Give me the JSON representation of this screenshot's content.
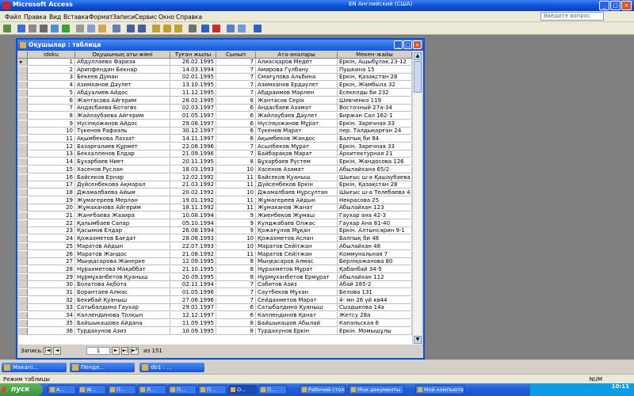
{
  "app": {
    "title": "Microsoft Access",
    "lang_indicator": "EN Английский (США)"
  },
  "menu": [
    "Файл",
    "Правка",
    "Вид",
    "Вставка",
    "Формат",
    "Записи",
    "Сервис",
    "Окно",
    "Справка"
  ],
  "help_placeholder": "Введите вопрос",
  "table_window": {
    "title": "Оқушылар : таблица",
    "columns": [
      "idoku",
      "Оқушының аты-жөні",
      "Туған жылы",
      "Сынып",
      "Ата-аналары",
      "Мекен-жайы"
    ],
    "rows": [
      [
        "1",
        "Абдуллаева Фариза",
        "26.02.1995",
        "7",
        "Алиасқаров Медет",
        "Еркін, Ащыбұлақ 23-12"
      ],
      [
        "2",
        "Арипфендин Бекнар",
        "14.03.1994",
        "7",
        "Амирова Гүлбану",
        "Пушкина 15"
      ],
      [
        "3",
        "Бекеев Думан",
        "02.01.1995",
        "7",
        "Смағұлова Альбина",
        "Еркін, Қазақстан 28"
      ],
      [
        "4",
        "Азимханов Дәулет",
        "13.10.1995",
        "7",
        "Азимханов Ердәулет",
        "Еркін, Жамбыла 32"
      ],
      [
        "5",
        "Абдуалиев Айдос",
        "11.12.1995",
        "7",
        "Абдраимов Марлен",
        "Есекелды би 232"
      ],
      [
        "6",
        "Жантасова Айгерим",
        "28.02.1995",
        "8",
        "Жантасов Серік",
        "Шевченко 119"
      ],
      [
        "7",
        "Андасбаева Ботагөз",
        "02.03.1997",
        "6",
        "Андасбаев Азамат",
        "Восточный 27а-34"
      ],
      [
        "8",
        "Жайлаубаева Айгерим",
        "01.05.1997",
        "6",
        "Жайлаубаев Дәулет",
        "Биржан Сал 162-1"
      ],
      [
        "9",
        "Нүсіпқожанов Айдос",
        "29.08.1997",
        "6",
        "Нүсіпқожанов Мұрат",
        "Еркін. Заречная 33"
      ],
      [
        "10",
        "Түкенов Рафаэль",
        "30.12.1997",
        "6",
        "Түкенов Марат",
        "пер. Талдықорған 24"
      ],
      [
        "11",
        "Ақымбекова Лаззат",
        "14.11.1997",
        "6",
        "Ақымбеков Жандос",
        "Балпық би 84"
      ],
      [
        "12",
        "Базарғалиев Құрмет",
        "22.08.1996",
        "7",
        "Асылбеков Мұрат",
        "Еркін. Заречная 33"
      ],
      [
        "13",
        "Бекхалленов Елдар",
        "21.09.1996",
        "7",
        "Байбарақов Марат",
        "Архитектурная 21"
      ],
      [
        "14",
        "Бұхарбаев Ниет",
        "20.11.1995",
        "8",
        "Бұхарбаев Рүстем",
        "Еркін, Жандосова 126"
      ],
      [
        "15",
        "Хасенов Руслан",
        "18.03.1993",
        "10",
        "Хасенов Азамат",
        "Абылайхана 65/2"
      ],
      [
        "16",
        "Байсеков Ернар",
        "12.02.1992",
        "11",
        "Байсеков Қуаныш",
        "Шығыс ш-а Қашаубаева 21"
      ],
      [
        "17",
        "Дүйсенбекова Ақмарал",
        "21.03.1992",
        "11",
        "Дүйсенбеков Еркін",
        "Еркін, Қазақстан 28"
      ],
      [
        "18",
        "Джамалбаева Айым",
        "20.02.1992",
        "10",
        "Джамалбаев Нұрсұлтан",
        "Шығыс ш-а Телебаева 4"
      ],
      [
        "19",
        "Жұмагереев Мерлан",
        "19.01.1992",
        "11",
        "Жұмагереев Айдын",
        "Некрасова 25"
      ],
      [
        "20",
        "Жұмаханова Айгерим",
        "18.11.1992",
        "11",
        "Жұмаханов Жанат",
        "Абылайхан 123"
      ],
      [
        "21",
        "Жанғбаева Жазира",
        "10.08.1994",
        "9",
        "Жиенбеков Жұмаш",
        "Гаухар ана 42-3"
      ],
      [
        "22",
        "Қалымбаев Сапар",
        "05.10.1994",
        "9",
        "Кулджабаев Олжас",
        "Гаухар Ана 81-40"
      ],
      [
        "23",
        "Қасымов Елдар",
        "26.08.1994",
        "9",
        "Қожағұлов Мұқан",
        "Еркін. Алтынсарин 9-1"
      ],
      [
        "24",
        "Қожахметов Бағдат",
        "28.08.1993",
        "10",
        "Қожахметов Аслан",
        "Балпық би 48"
      ],
      [
        "25",
        "Маратов Айдын",
        "22.07.1993",
        "10",
        "Маратов Сейітжан",
        "Абылайхан 48"
      ],
      [
        "26",
        "Маратов Жандос",
        "21.08.1992",
        "11",
        "Маратов Сейітжан",
        "Коммунальная 7"
      ],
      [
        "27",
        "Мыңқасарова Жәнерке",
        "12.09.1995",
        "8",
        "Мыңқасаров Алмас",
        "Берліқожанова 80"
      ],
      [
        "28",
        "Нұрахметова Мақаббат",
        "21.10.1995",
        "8",
        "Нұрахметов Мұрат",
        "Қабанбай 34-5"
      ],
      [
        "29",
        "Нұрмұханбетов Қуаныш",
        "20.09.1995",
        "8",
        "Нұрмұханбетов Ермұрат",
        "Абылайхан 112"
      ],
      [
        "30",
        "Болатова Ақбота",
        "02.11.1994",
        "7",
        "Сабитов Азиз",
        "Абай 285-2"
      ],
      [
        "31",
        "Борантаев Алмас",
        "01.05.1996",
        "7",
        "Саутбеков Мұхан",
        "Белова 131"
      ],
      [
        "32",
        "Бекибай Қуаныш",
        "27.06.1996",
        "7",
        "Сейдахметов Марат",
        "4- мн 26 үй кв44"
      ],
      [
        "33",
        "Сатыбалдина Гаухар",
        "29.01.1997",
        "6",
        "Сатыбалдина Қуаныш",
        "Сыздыкова 14а"
      ],
      [
        "34",
        "Каллендинова Толқын",
        "12.12.1997",
        "6",
        "Каллендинов Қанат",
        "Жетсу 28а"
      ],
      [
        "35",
        "Байшыкашова Айдана",
        "11.09.1995",
        "8",
        "Байшыкашов Абылай",
        "Капальская 6"
      ],
      [
        "36",
        "Турдахунов Азиз",
        "10.09.1995",
        "8",
        "Турдахунов Еркін",
        "Еркін. Момышұлы"
      ]
    ]
  },
  "record_nav": {
    "label": "Запись:",
    "current": "1",
    "of_label": "из",
    "total": "151"
  },
  "minimized_windows": [
    "Макапі...",
    "Пенде...",
    "db1 : ..."
  ],
  "status": {
    "left": "Режим таблицы",
    "right": "NUM"
  },
  "taskbar": {
    "start": "пуск",
    "items": [
      "A...",
      "W...",
      "П...",
      "Л...",
      "П...",
      "П...",
      "О...",
      "П...",
      "Рабочий стол",
      "Мои документы",
      "Мой компьютер"
    ],
    "clock": "10:11"
  }
}
